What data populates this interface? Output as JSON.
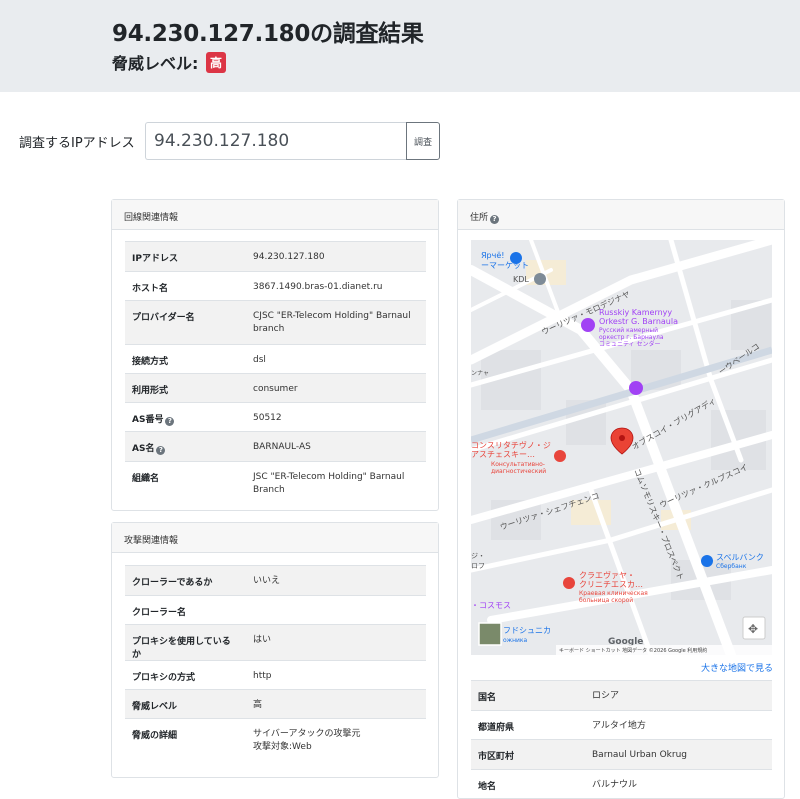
{
  "header": {
    "ip": "94.230.127.180",
    "title_suffix": "の調査結果",
    "threat_label": "脅威レベル:",
    "threat_badge": "高"
  },
  "search": {
    "label": "調査するIPアドレス",
    "value": "94.230.127.180",
    "button": "調査"
  },
  "line_info": {
    "title": "回線関連情報",
    "rows": [
      {
        "key": "IPアドレス",
        "value": "94.230.127.180"
      },
      {
        "key": "ホスト名",
        "value": "3867.1490.bras-01.dianet.ru"
      },
      {
        "key": "プロバイダー名",
        "value": "CJSC \"ER-Telecom Holding\" Barnaul branch"
      },
      {
        "key": "接続方式",
        "value": "dsl"
      },
      {
        "key": "利用形式",
        "value": "consumer"
      },
      {
        "key": "AS番号",
        "value": "50512"
      },
      {
        "key": "AS名",
        "value": "BARNAUL-AS"
      },
      {
        "key": "組織名",
        "value": "JSC \"ER-Telecom Holding\" Barnaul Branch"
      }
    ]
  },
  "attack_info": {
    "title": "攻撃関連情報",
    "rows": [
      {
        "key": "クローラーであるか",
        "value": "いいえ"
      },
      {
        "key": "クローラー名",
        "value": ""
      },
      {
        "key": "プロキシを使用しているか",
        "value": "はい"
      },
      {
        "key": "プロキシの方式",
        "value": "http"
      },
      {
        "key": "脅威レベル",
        "value": "高"
      },
      {
        "key": "脅威の詳細",
        "value": "サイバーアタックの攻撃元",
        "value2": "攻撃対象:Web"
      }
    ]
  },
  "address": {
    "title": "住所",
    "map_link": "大きな地図で見る",
    "rows": [
      {
        "key": "国名",
        "value": "ロシア"
      },
      {
        "key": "都道府県",
        "value": "アルタイ地方"
      },
      {
        "key": "市区町村",
        "value": "Barnaul Urban Okrug"
      },
      {
        "key": "地名",
        "value": "バルナウル"
      }
    ]
  },
  "map": {
    "labels": {
      "street1": "ウーリツァ・モロデジナヤ",
      "street2": "ウーリツァ・シェフチェンコ",
      "street3": "コムソモリスキー・プロスペクト",
      "street4": "オブスコイ・ブリグアディ",
      "street5": "ウーリツァ・クルプスコイ",
      "poi1": "Russkiy Kamernyy",
      "poi1b": "Orkestr G. Barnaula",
      "poi1c": "Русский камерный",
      "poi1d": "оркестр г. Барнаула",
      "poi1e": "コミュニティ センター",
      "poi2": "コンスリタチヴノ・ジ",
      "poi2b": "アスチェスキー…",
      "poi2c": "Консультативно-",
      "poi2d": "диагностический",
      "poi3": "クラエヴァヤ・",
      "poi3b": "クリニチエスカ…",
      "poi3c": "Краевая клиническая",
      "poi3d": "больница скорой",
      "poi4": "スベルバンク",
      "poi4b": "Сбербанк",
      "poi5": "Ярчё!",
      "poi5b": "ーマーケット",
      "poi6": "KDL",
      "poi7": "・コスモス",
      "poi8": "フドシュニカ",
      "poi8b": "ожника",
      "poi9": "ンナャ",
      "poi10": "ーウベールコ",
      "poi11": "ジ・",
      "poi12": "ロフ",
      "google": "Google",
      "attribution": "キーボード ショートカット   地図データ ©2026 Google   利用規約"
    },
    "marker_color": "#ea4335"
  }
}
